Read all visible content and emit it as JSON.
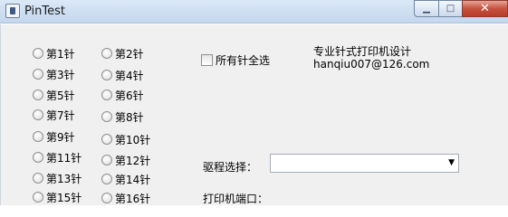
{
  "window": {
    "title": "PinTest",
    "buttons": {
      "minimize": "▁",
      "maximize": "□",
      "close": "✕"
    }
  },
  "pins": [
    "第1针",
    "第2针",
    "第3针",
    "第4针",
    "第5针",
    "第6针",
    "第7针",
    "第8针",
    "第9针",
    "第10针",
    "第11针",
    "第12针",
    "第13针",
    "第14针",
    "第15针",
    "第16针"
  ],
  "select_all_label": "所有针全选",
  "info": {
    "line1": "专业针式打印机设计",
    "line2": "hanqiu007@126.com"
  },
  "driver": {
    "label": "驱程选择：",
    "value": "",
    "dropdown_icon": "chevron-down-icon"
  },
  "port": {
    "label": "打印机端口："
  }
}
